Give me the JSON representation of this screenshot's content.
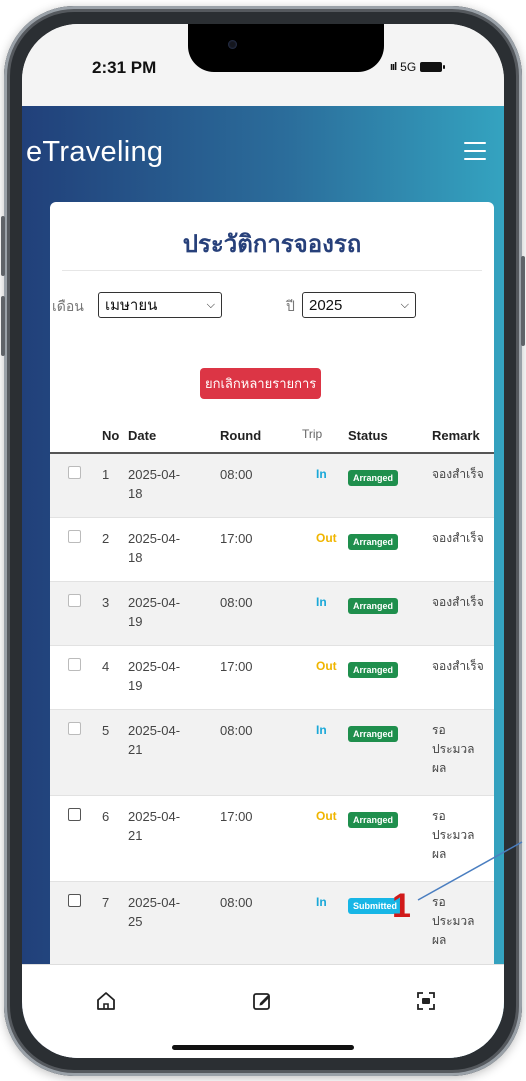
{
  "status_bar": {
    "time": "2:31 PM",
    "signal": "ııl",
    "network": "5G"
  },
  "app": {
    "brand": "eTraveling"
  },
  "page": {
    "title": "ประวัติการจองรถ",
    "month_label": "เดือน",
    "month_value": "เมษายน",
    "year_label": "ปี",
    "year_value": "2025",
    "cancel_multi_label": "ยกเลิกหลายรายการ"
  },
  "table": {
    "headers": {
      "no": "No",
      "date": "Date",
      "round": "Round",
      "trip": "Trip",
      "status": "Status",
      "remark": "Remark"
    },
    "rows": [
      {
        "no": "1",
        "date": "2025-04-18",
        "round": "08:00",
        "trip": "In",
        "status": "Arranged",
        "remark": "จองสำเร็จ"
      },
      {
        "no": "2",
        "date": "2025-04-18",
        "round": "17:00",
        "trip": "Out",
        "status": "Arranged",
        "remark": "จองสำเร็จ"
      },
      {
        "no": "3",
        "date": "2025-04-19",
        "round": "08:00",
        "trip": "In",
        "status": "Arranged",
        "remark": "จองสำเร็จ"
      },
      {
        "no": "4",
        "date": "2025-04-19",
        "round": "17:00",
        "trip": "Out",
        "status": "Arranged",
        "remark": "จองสำเร็จ"
      },
      {
        "no": "5",
        "date": "2025-04-21",
        "round": "08:00",
        "trip": "In",
        "status": "Arranged",
        "remark": "รอประมวลผล"
      },
      {
        "no": "6",
        "date": "2025-04-21",
        "round": "17:00",
        "trip": "Out",
        "status": "Arranged",
        "remark": "รอประมวลผล"
      },
      {
        "no": "7",
        "date": "2025-04-25",
        "round": "08:00",
        "trip": "In",
        "status": "Submitted",
        "remark": "รอประมวลผล"
      }
    ]
  },
  "annotation": {
    "number": "1"
  },
  "bottom_nav": [
    "home-icon",
    "edit-icon",
    "scan-icon"
  ],
  "colors": {
    "header_start": "#21407a",
    "header_end": "#34a3c0",
    "arranged": "#1f8f4d",
    "submitted": "#17b6e6",
    "danger": "#dc3545"
  }
}
